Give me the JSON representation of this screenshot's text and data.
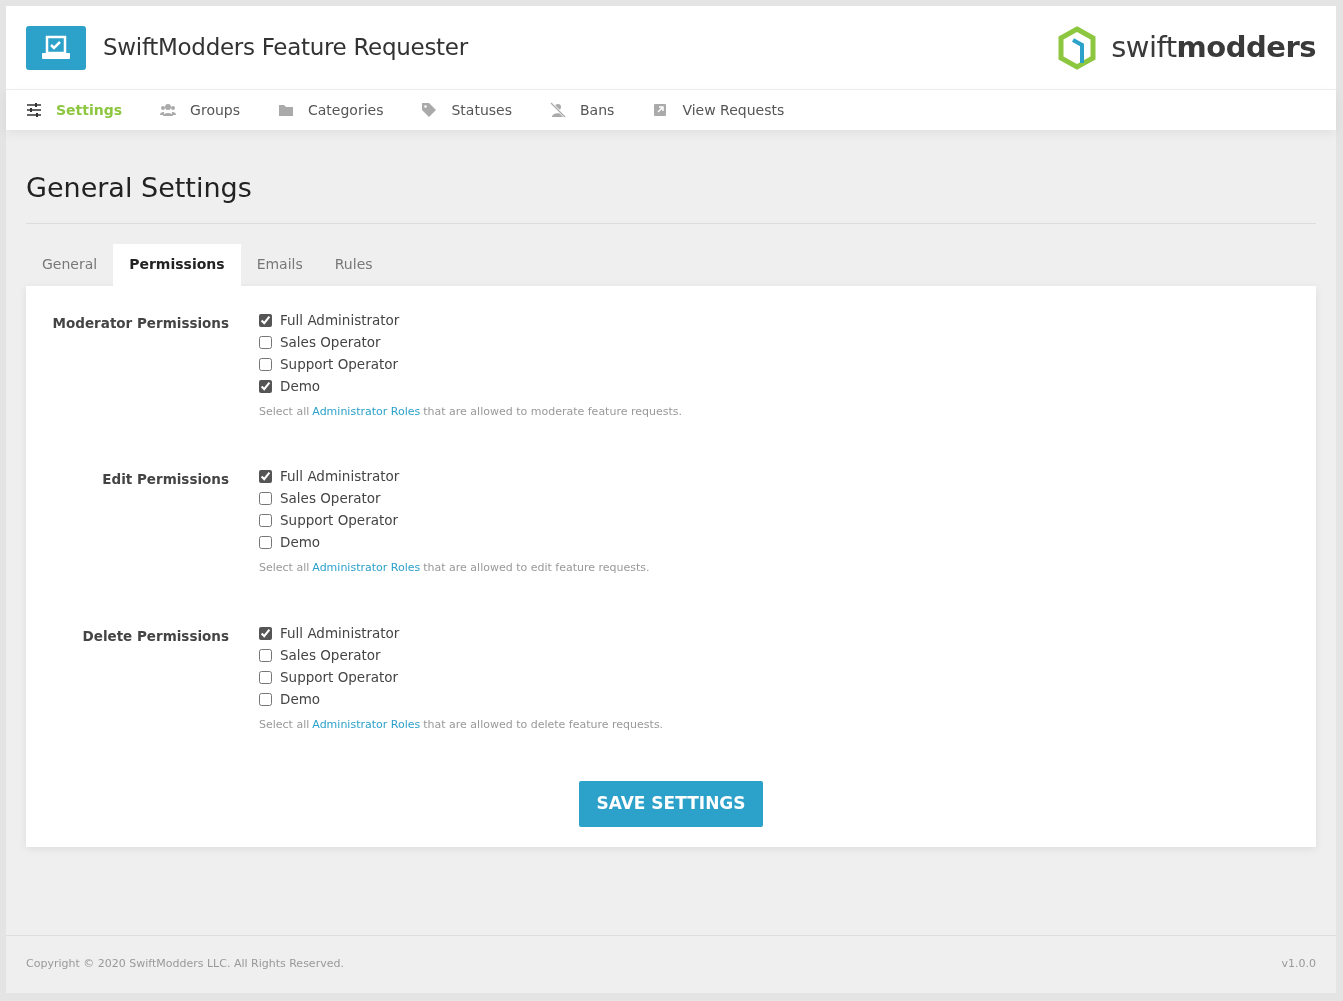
{
  "header": {
    "title": "SwiftModders Feature Requester",
    "logo_text": "swift**modders**"
  },
  "nav": [
    {
      "label": "Settings",
      "selected": true
    },
    {
      "label": "Groups",
      "selected": false
    },
    {
      "label": "Categories",
      "selected": false
    },
    {
      "label": "Statuses",
      "selected": false
    },
    {
      "label": "Bans",
      "selected": false
    },
    {
      "label": "View Requests",
      "selected": false
    }
  ],
  "page_title": "General Settings",
  "tabs": [
    {
      "label": "General",
      "selected": false
    },
    {
      "label": "Permissions",
      "selected": true
    },
    {
      "label": "Emails",
      "selected": false
    },
    {
      "label": "Rules",
      "selected": false
    }
  ],
  "sections": [
    {
      "label": "Moderator Permissions",
      "options": [
        {
          "label": "Full Administrator",
          "checked": true
        },
        {
          "label": "Sales Operator",
          "checked": false
        },
        {
          "label": "Support Operator",
          "checked": false
        },
        {
          "label": "Demo",
          "checked": true
        }
      ],
      "help_prefix": "Select all",
      "help_link": "Administrator Roles",
      "help_suffix": "that are allowed to moderate feature requests."
    },
    {
      "label": "Edit Permissions",
      "options": [
        {
          "label": "Full Administrator",
          "checked": true
        },
        {
          "label": "Sales Operator",
          "checked": false
        },
        {
          "label": "Support Operator",
          "checked": false
        },
        {
          "label": "Demo",
          "checked": false
        }
      ],
      "help_prefix": "Select all",
      "help_link": "Administrator Roles",
      "help_suffix": "that are allowed to edit feature requests."
    },
    {
      "label": "Delete Permissions",
      "options": [
        {
          "label": "Full Administrator",
          "checked": true
        },
        {
          "label": "Sales Operator",
          "checked": false
        },
        {
          "label": "Support Operator",
          "checked": false
        },
        {
          "label": "Demo",
          "checked": false
        }
      ],
      "help_prefix": "Select all",
      "help_link": "Administrator Roles",
      "help_suffix": "that are allowed to delete feature requests."
    }
  ],
  "save_button": "SAVE SETTINGS",
  "footer": {
    "copyright": "Copyright © 2020 SwiftModders LLC. All Rights Reserved.",
    "version": "v1.0.0"
  }
}
